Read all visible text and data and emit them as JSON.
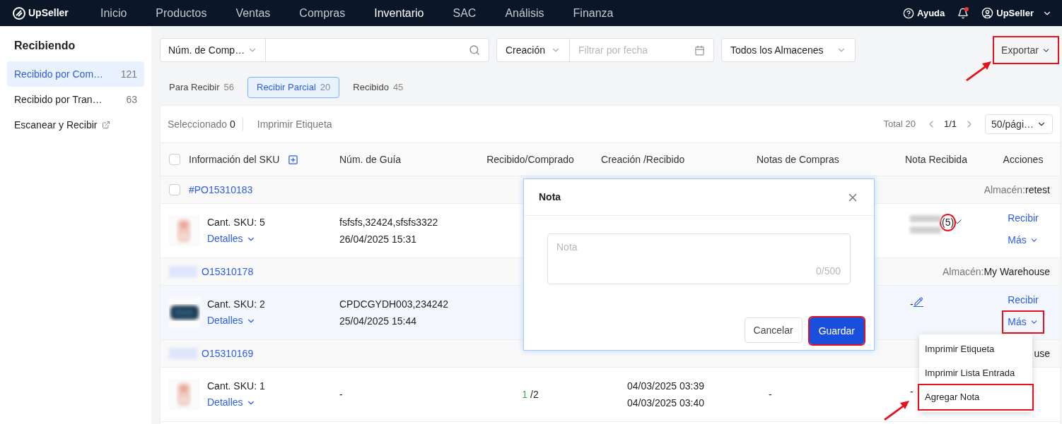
{
  "nav": {
    "logo": "UpSeller",
    "items": [
      {
        "label": "Inicio",
        "selected": false
      },
      {
        "label": "Productos",
        "selected": false
      },
      {
        "label": "Ventas",
        "selected": false
      },
      {
        "label": "Compras",
        "selected": false
      },
      {
        "label": "Inventario",
        "selected": true
      },
      {
        "label": "SAC",
        "selected": false
      },
      {
        "label": "Análisis",
        "selected": false
      },
      {
        "label": "Finanza",
        "selected": false
      }
    ],
    "help": "Ayuda",
    "notification_dot": true,
    "user": "UpSeller"
  },
  "sidebar": {
    "title": "Recibiendo",
    "items": [
      {
        "label": "Recibido por Com…",
        "count": "121",
        "selected": true,
        "kind": "count"
      },
      {
        "label": "Recibido por Tran…",
        "count": "63",
        "selected": false,
        "kind": "count"
      },
      {
        "label": "Escanear y Recibir",
        "selected": false,
        "kind": "external"
      }
    ]
  },
  "filters": {
    "search_type": "Núm. de Comp…",
    "date_type": "Creación",
    "date_placeholder": "Filtrar por fecha",
    "warehouse": "Todos los Almacenes"
  },
  "export_button": {
    "label": "Exportar",
    "annotated": true,
    "arrow": true
  },
  "tabs": [
    {
      "label": "Para Recibir",
      "count": "56",
      "selected": false
    },
    {
      "label": "Recibir Parcial",
      "count": "20",
      "selected": true
    },
    {
      "label": "Recibido",
      "count": "45",
      "selected": false
    }
  ],
  "toolbar": {
    "selected_label": "Seleccionado",
    "selected_count": "0",
    "print_label": "Imprimir Etiqueta",
    "total": "Total 20",
    "page": "1/1",
    "page_size": "50/pági…"
  },
  "table": {
    "columns": [
      "Información del SKU",
      "Núm. de Guía",
      "Recibido/Comprado",
      "Creación /Recibido",
      "Notas de Compras",
      "Nota Recibida",
      "Acciones"
    ],
    "select_all_checked": false,
    "groups": [
      {
        "po": "#PO15310183",
        "checked": false,
        "warehouse_label": "Almacén:",
        "warehouse": "retest",
        "rows": [
          {
            "image": {
              "kind": "bottle"
            },
            "sku_qty": "Cant. SKU: 5",
            "details": "Detalles",
            "guide": "fsfsfs,32424,sfsfs3322",
            "guide_date": "26/04/2025 15:31",
            "received_note": {
              "kind": "count",
              "text": "(5)",
              "annotated": true
            },
            "actions": {
              "receive": "Recibir",
              "more": "Más",
              "annotated": false
            },
            "highlighted": false
          }
        ]
      },
      {
        "po": "O15310178",
        "warehouse_label": "Almacén:",
        "warehouse": "My Warehouse",
        "rows": [
          {
            "image": {
              "kind": "case"
            },
            "sku_qty": "Cant. SKU: 2",
            "details": "Detalles",
            "guide": "CPDCGYDH003,234242",
            "guide_date": "25/04/2025 15:44",
            "received_note": {
              "kind": "edit",
              "text": "-"
            },
            "actions": {
              "receive": "Recibir",
              "more": "Más",
              "annotated": true
            },
            "highlighted": true
          }
        ]
      },
      {
        "po": "O15310169",
        "warehouse": "use",
        "rows": [
          {
            "image": {
              "kind": "bottle"
            },
            "sku_qty": "Cant. SKU: 1",
            "details": "Detalles",
            "guide": "-",
            "received": "1",
            "purchased": "/2",
            "created": "04/03/2025 03:39",
            "received_at": "04/03/2025 03:40",
            "purchase_note": "-",
            "received_note": {
              "kind": "plain",
              "text": "-"
            },
            "highlighted": false
          }
        ]
      }
    ]
  },
  "modal": {
    "title": "Nota",
    "placeholder": "Nota",
    "counter": "0/500",
    "cancel": "Cancelar",
    "save": {
      "label": "Guardar",
      "annotated": true
    }
  },
  "menu": {
    "items": [
      {
        "label": "Imprimir Etiqueta",
        "annotated": false,
        "arrow": false
      },
      {
        "label": "Imprimir Lista Entrada",
        "annotated": false,
        "arrow": false
      },
      {
        "label": "Agregar Nota",
        "annotated": true,
        "arrow": true
      }
    ]
  }
}
